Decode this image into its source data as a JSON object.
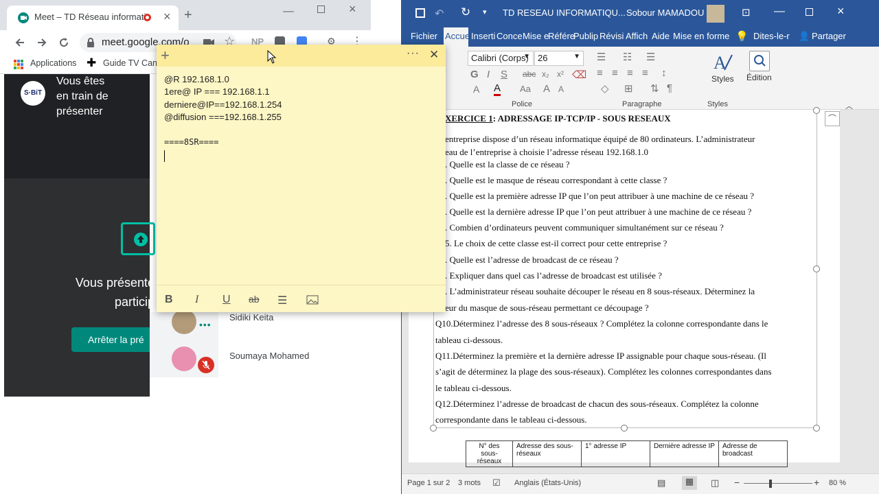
{
  "chrome": {
    "tab_title": "Meet – TD Réseau informatic",
    "url": "meet.google.com/o",
    "bookmarks": [
      "Applications",
      "Guide TV Cana"
    ],
    "extension_labels": [
      "NP"
    ],
    "colors": {
      "tabbar": "#dee1e6",
      "recording": "#d93025"
    }
  },
  "meet": {
    "logo_text": "S·BiT",
    "presenting_lines": [
      "Vous êtes",
      "en train de",
      "présenter"
    ],
    "big_text_lines": [
      "Vous présente",
      "particip"
    ],
    "stop_button": "Arrêter la pré",
    "participants": [
      {
        "name": "Sidiki Keita",
        "status": "more-dots-icon"
      },
      {
        "name": "Soumaya Mohamed",
        "status": "mic-off-icon"
      }
    ],
    "colors": {
      "accent": "#00897b",
      "dark": "#202124"
    }
  },
  "sticky_note": {
    "lines": [
      "@R 192.168.1.0",
      "1ere@ IP === 192.168.1.1",
      "derniere@IP==192.168.1.254",
      "@diffusion ===192.168.1.255",
      "",
      "====8SR===="
    ],
    "toolbar": [
      "bold-icon",
      "italic-icon",
      "underline-icon",
      "strikethrough-icon",
      "list-icon",
      "image-icon"
    ],
    "toolbar_labels": {
      "bold": "B",
      "italic": "I",
      "underline": "U",
      "strike": "ab"
    },
    "colors": {
      "body": "#fdf6c5",
      "header": "#fbeb9b"
    }
  },
  "word": {
    "title": "TD RESEAU INFORMATIQU...",
    "user": "Sobour MAMADOU",
    "ribbon_tabs": [
      "Fichier",
      "Accue",
      "Inserti",
      "Conce",
      "Mise e",
      "Référe",
      "Publip",
      "Révisi",
      "Affich",
      "Aide",
      "Mise en forme",
      "Dites-le-r",
      "Partager"
    ],
    "font_name": "Calibri (Corps)",
    "font_size": "26",
    "groups": [
      "Police",
      "Paragraphe",
      "Styles"
    ],
    "styles_label": "Styles",
    "edition_label": "Édition",
    "doc": {
      "heading_prefix": "XERCICE 1",
      "heading_rest": ": ADRESSAGE IP-TCP/IP - SOUS RESEAUX",
      "lines": [
        "entreprise dispose d’un réseau informatique équipé de 80 ordinateurs. L’administrateur",
        "eau de l’entreprise à choisie l’adresse réseau 192.168.1.0",
        ". Quelle est la classe de ce réseau ?",
        ". Quelle est le masque de réseau correspondant à cette classe ?",
        ". Quelle est la première adresse IP que l’on peut attribuer à une machine de ce réseau ?",
        ". Quelle est la dernière adresse IP que l’on peut attribuer à une machine de ce réseau ?",
        ". Combien d’ordinateurs peuvent communiquer simultanément sur ce réseau ?",
        "5. Le choix de cette classe est-il correct pour cette entreprise ?",
        ". Quelle est l’adresse de broadcast de ce réseau ?",
        ". Expliquer dans quel cas l’adresse de broadcast est utilisée ?",
        ". L’administrateur réseau souhaite découper le réseau en 8 sous-réseaux. Déterminez la",
        "eur du masque de sous-réseau permettant ce découpage ?",
        "Q10.Déterminez l’adresse des 8 sous-réseaux ? Complétez la colonne correspondante dans le",
        "tableau ci-dessous.",
        "Q11.Déterminez la première  et la dernière adresse IP assignable pour chaque sous-réseau. (Il",
        "s’agit de déterminez la plage des sous-réseaux). Complétez les colonnes correspondantes dans",
        "le tableau ci-dessous.",
        " Q12.Déterminez l’adresse de broadcast de chacun des sous-réseaux. Complétez la colonne",
        "correspondante dans le tableau ci-dessous."
      ],
      "table_headers": [
        "N° des sous-réseaux",
        "Adresse des sous-réseaux",
        "1° adresse IP",
        "Dernière adresse IP",
        "Adresse de broadcast"
      ]
    },
    "status": {
      "page": "Page 1 sur 2",
      "words": "3 mots",
      "language": "Anglais (États-Unis)",
      "zoom": "80 %"
    },
    "colors": {
      "brand": "#2b579a",
      "ribbon": "#f3f3f3"
    }
  }
}
